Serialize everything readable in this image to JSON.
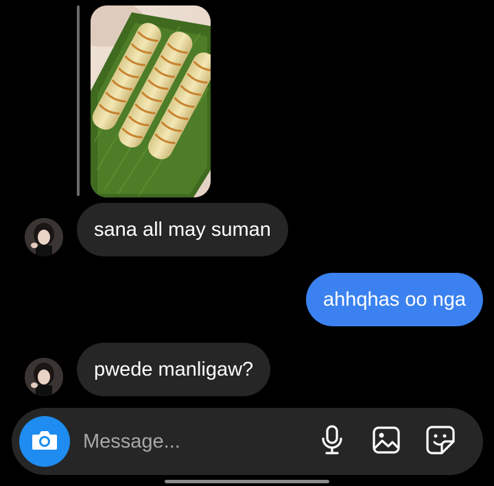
{
  "messages": [
    {
      "from": "them",
      "text": "sana all may suman"
    },
    {
      "from": "me",
      "text": "ahhqhas oo nga"
    },
    {
      "from": "them",
      "text": "pwede manligaw?"
    }
  ],
  "composer": {
    "placeholder": "Message..."
  },
  "icons": {
    "camera": "camera-icon",
    "mic": "microphone-icon",
    "gallery": "image-gallery-icon",
    "sticker": "sticker-icon"
  },
  "colors": {
    "background": "#000000",
    "incoming_bubble": "#262626",
    "outgoing_bubble": "#3b82f0",
    "camera_button": "#1e8cf0"
  }
}
